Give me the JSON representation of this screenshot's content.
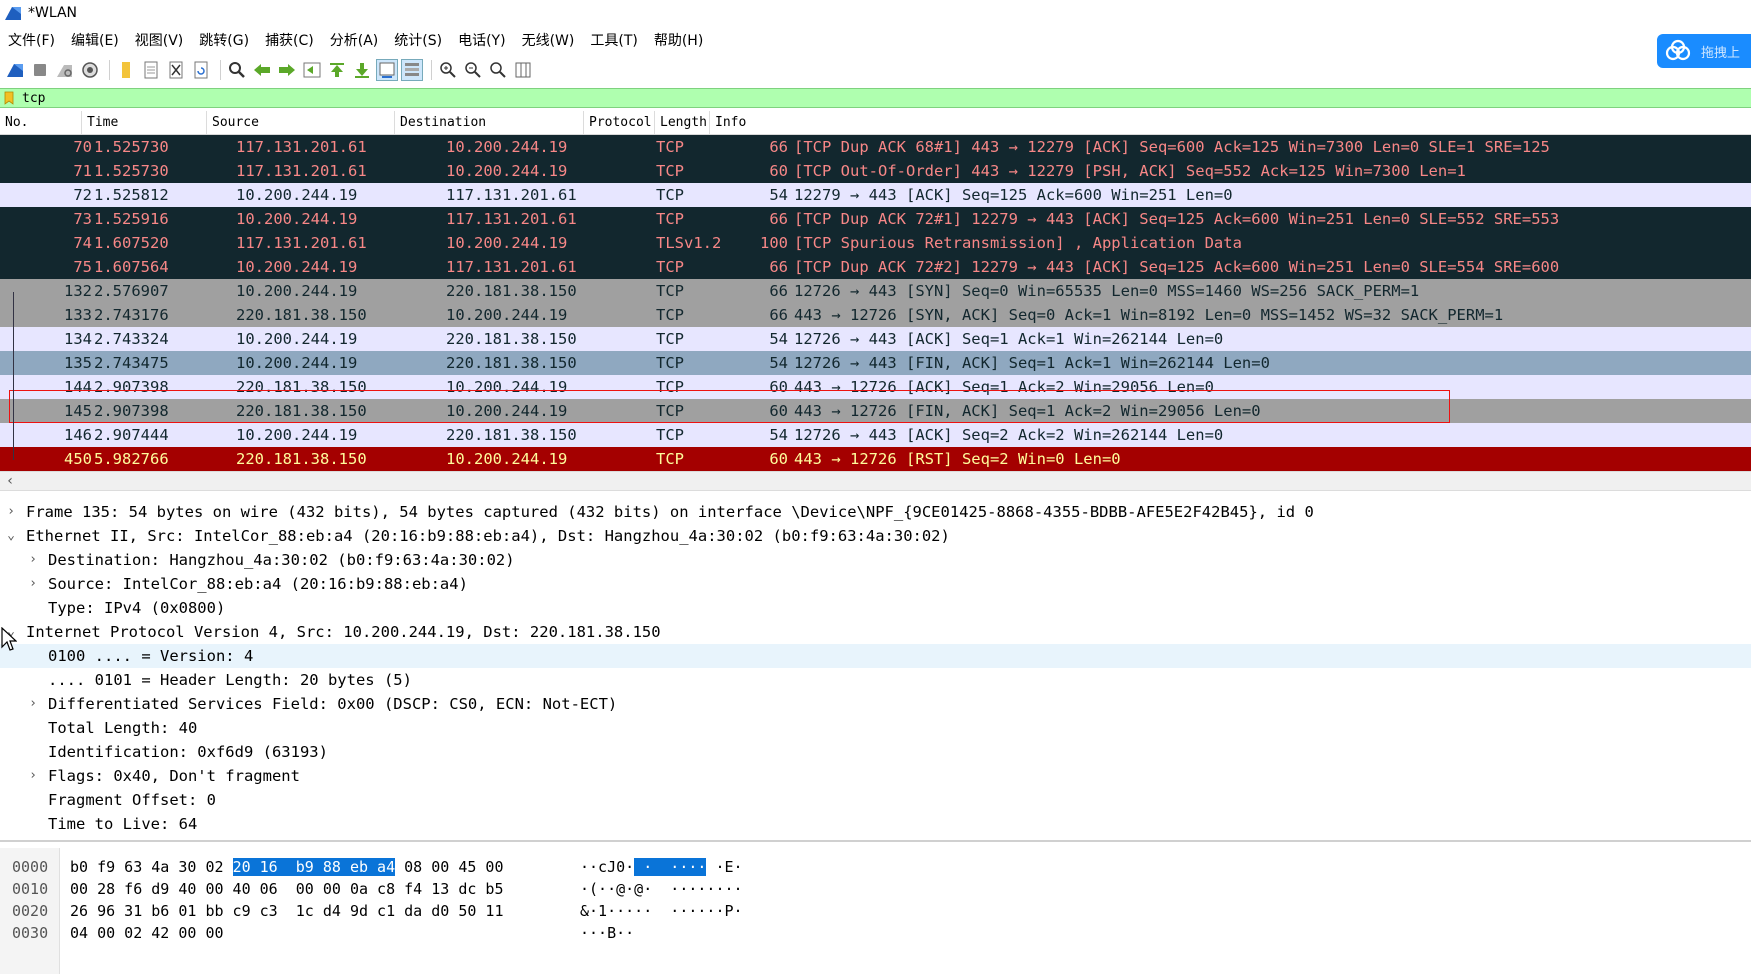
{
  "window": {
    "title": "*WLAN"
  },
  "menu": [
    "文件(F)",
    "编辑(E)",
    "视图(V)",
    "跳转(G)",
    "捕获(C)",
    "分析(A)",
    "统计(S)",
    "电话(Y)",
    "无线(W)",
    "工具(T)",
    "帮助(H)"
  ],
  "toolbar": {
    "icons": [
      "shark-fin-start-icon",
      "stop-capture-icon",
      "restart-capture-icon",
      "capture-options-icon",
      "open-file-icon",
      "save-file-icon",
      "close-file-icon",
      "reload-file-icon",
      "find-packet-icon",
      "go-back-icon",
      "go-forward-icon",
      "go-to-packet-icon",
      "go-first-icon",
      "go-last-icon",
      "autoscroll-icon",
      "colorize-icon",
      "zoom-in-icon",
      "zoom-out-icon",
      "zoom-normal-icon",
      "resize-columns-icon"
    ]
  },
  "cloud_widget": {
    "label": "拖拽上"
  },
  "filter": {
    "value": "tcp"
  },
  "packet_list": {
    "columns": [
      "No.",
      "Time",
      "Source",
      "Destination",
      "Protocol",
      "Length",
      "Info"
    ],
    "rows": [
      {
        "no": "70",
        "time": "1.525730",
        "src": "117.131.201.61",
        "dst": "10.200.244.19",
        "proto": "TCP",
        "len": "66",
        "info": "[TCP Dup ACK 68#1] 443 → 12279 [ACK] Seq=600 Ack=125 Win=7300 Len=0 SLE=1 SRE=125",
        "style": "dark"
      },
      {
        "no": "71",
        "time": "1.525730",
        "src": "117.131.201.61",
        "dst": "10.200.244.19",
        "proto": "TCP",
        "len": "60",
        "info": "[TCP Out-Of-Order] 443 → 12279 [PSH, ACK] Seq=552 Ack=125 Win=7300 Len=1",
        "style": "dark"
      },
      {
        "no": "72",
        "time": "1.525812",
        "src": "10.200.244.19",
        "dst": "117.131.201.61",
        "proto": "TCP",
        "len": "54",
        "info": "12279 → 443 [ACK] Seq=125 Ack=600 Win=251 Len=0",
        "style": "light"
      },
      {
        "no": "73",
        "time": "1.525916",
        "src": "10.200.244.19",
        "dst": "117.131.201.61",
        "proto": "TCP",
        "len": "66",
        "info": "[TCP Dup ACK 72#1] 12279 → 443 [ACK] Seq=125 Ack=600 Win=251 Len=0 SLE=552 SRE=553",
        "style": "dark"
      },
      {
        "no": "74",
        "time": "1.607520",
        "src": "117.131.201.61",
        "dst": "10.200.244.19",
        "proto": "TLSv1.2",
        "len": "100",
        "info": "[TCP Spurious Retransmission] , Application Data",
        "style": "dark"
      },
      {
        "no": "75",
        "time": "1.607564",
        "src": "10.200.244.19",
        "dst": "117.131.201.61",
        "proto": "TCP",
        "len": "66",
        "info": "[TCP Dup ACK 72#2] 12279 → 443 [ACK] Seq=125 Ack=600 Win=251 Len=0 SLE=554 SRE=600",
        "style": "dark"
      },
      {
        "no": "132",
        "time": "2.576907",
        "src": "10.200.244.19",
        "dst": "220.181.38.150",
        "proto": "TCP",
        "len": "66",
        "info": "12726 → 443 [SYN] Seq=0 Win=65535 Len=0 MSS=1460 WS=256 SACK_PERM=1",
        "style": "gray"
      },
      {
        "no": "133",
        "time": "2.743176",
        "src": "220.181.38.150",
        "dst": "10.200.244.19",
        "proto": "TCP",
        "len": "66",
        "info": "443 → 12726 [SYN, ACK] Seq=0 Ack=1 Win=8192 Len=0 MSS=1452 WS=32 SACK_PERM=1",
        "style": "gray"
      },
      {
        "no": "134",
        "time": "2.743324",
        "src": "10.200.244.19",
        "dst": "220.181.38.150",
        "proto": "TCP",
        "len": "54",
        "info": "12726 → 443 [ACK] Seq=1 Ack=1 Win=262144 Len=0",
        "style": "light"
      },
      {
        "no": "135",
        "time": "2.743475",
        "src": "10.200.244.19",
        "dst": "220.181.38.150",
        "proto": "TCP",
        "len": "54",
        "info": "12726 → 443 [FIN, ACK] Seq=1 Ack=1 Win=262144 Len=0",
        "style": "sel"
      },
      {
        "no": "144",
        "time": "2.907398",
        "src": "220.181.38.150",
        "dst": "10.200.244.19",
        "proto": "TCP",
        "len": "60",
        "info": "443 → 12726 [ACK] Seq=1 Ack=2 Win=29056 Len=0",
        "style": "light"
      },
      {
        "no": "145",
        "time": "2.907398",
        "src": "220.181.38.150",
        "dst": "10.200.244.19",
        "proto": "TCP",
        "len": "60",
        "info": "443 → 12726 [FIN, ACK] Seq=1 Ack=2 Win=29056 Len=0",
        "style": "gray"
      },
      {
        "no": "146",
        "time": "2.907444",
        "src": "10.200.244.19",
        "dst": "220.181.38.150",
        "proto": "TCP",
        "len": "54",
        "info": "12726 → 443 [ACK] Seq=2 Ack=2 Win=262144 Len=0",
        "style": "light"
      },
      {
        "no": "450",
        "time": "5.982766",
        "src": "220.181.38.150",
        "dst": "10.200.244.19",
        "proto": "TCP",
        "len": "60",
        "info": "443 → 12726 [RST] Seq=2 Win=0 Len=0",
        "style": "red"
      }
    ]
  },
  "details": [
    {
      "toggle": "›",
      "indent": 0,
      "text": "Frame 135: 54 bytes on wire (432 bits), 54 bytes captured (432 bits) on interface \\Device\\NPF_{9CE01425-8868-4355-BDBB-AFE5E2F42B45}, id 0"
    },
    {
      "toggle": "⌄",
      "indent": 0,
      "text": "Ethernet II, Src: IntelCor_88:eb:a4 (20:16:b9:88:eb:a4), Dst: Hangzhou_4a:30:02 (b0:f9:63:4a:30:02)"
    },
    {
      "toggle": "›",
      "indent": 1,
      "text": "Destination: Hangzhou_4a:30:02 (b0:f9:63:4a:30:02)"
    },
    {
      "toggle": "›",
      "indent": 1,
      "text": "Source: IntelCor_88:eb:a4 (20:16:b9:88:eb:a4)"
    },
    {
      "toggle": "",
      "indent": 1,
      "text": "Type: IPv4 (0x0800)"
    },
    {
      "toggle": "⌄",
      "indent": 0,
      "text": "Internet Protocol Version 4, Src: 10.200.244.19, Dst: 220.181.38.150"
    },
    {
      "toggle": "",
      "indent": 1,
      "text": "0100 .... = Version: 4",
      "highlight": true
    },
    {
      "toggle": "",
      "indent": 1,
      "text": ".... 0101 = Header Length: 20 bytes (5)"
    },
    {
      "toggle": "›",
      "indent": 1,
      "text": "Differentiated Services Field: 0x00 (DSCP: CS0, ECN: Not-ECT)"
    },
    {
      "toggle": "",
      "indent": 1,
      "text": "Total Length: 40"
    },
    {
      "toggle": "",
      "indent": 1,
      "text": "Identification: 0xf6d9 (63193)"
    },
    {
      "toggle": "›",
      "indent": 1,
      "text": "Flags: 0x40, Don't fragment"
    },
    {
      "toggle": "",
      "indent": 1,
      "text": "Fragment Offset: 0"
    },
    {
      "toggle": "",
      "indent": 1,
      "text": "Time to Live: 64"
    }
  ],
  "bytes": [
    {
      "offset": "0000",
      "hex_pre": "b0 f9 63 4a 30 02 ",
      "hex_hl": "20 16  b9 88 eb a4",
      "hex_post": " 08 00 45 00",
      "ascii_pre": "··cJ0·",
      "ascii_hl": " ·  ····",
      "ascii_post": " ·E·"
    },
    {
      "offset": "0010",
      "hex_pre": "00 28 f6 d9 40 00 40 06  00 00 0a c8 f4 13 dc b5",
      "hex_hl": "",
      "hex_post": "",
      "ascii_pre": "·(··@·@·  ········",
      "ascii_hl": "",
      "ascii_post": ""
    },
    {
      "offset": "0020",
      "hex_pre": "26 96 31 b6 01 bb c9 c3  1c d4 9d c1 da d0 50 11",
      "hex_hl": "",
      "hex_post": "",
      "ascii_pre": "&·1·····  ······P·",
      "ascii_hl": "",
      "ascii_post": ""
    },
    {
      "offset": "0030",
      "hex_pre": "04 00 02 42 00 00",
      "hex_hl": "",
      "hex_post": "",
      "ascii_pre": "···B··",
      "ascii_hl": "",
      "ascii_post": ""
    }
  ]
}
